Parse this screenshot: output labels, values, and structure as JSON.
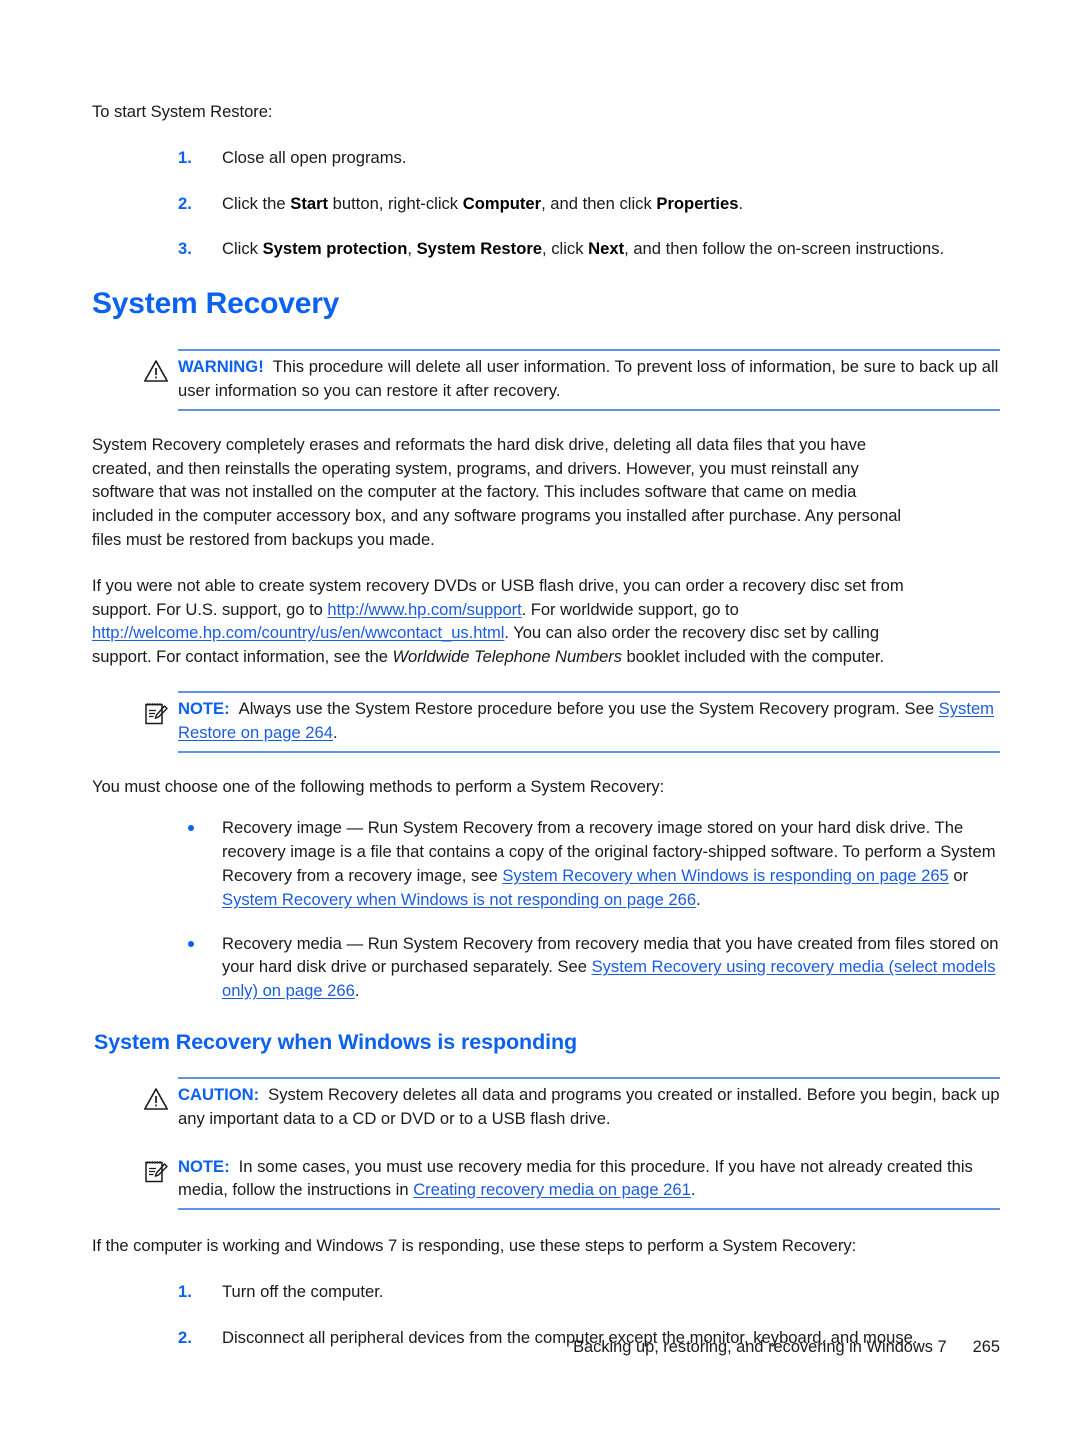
{
  "page": {
    "intro_line": "To start System Restore:",
    "steps_top": [
      {
        "num": "1.",
        "text": "Close all open programs."
      },
      {
        "num": "2.",
        "text": "Click the Start button, right-click Computer, and then click Properties."
      },
      {
        "num": "3.",
        "text": "Click System protection, System Restore, click Next, and then follow the on-screen instructions."
      }
    ],
    "heading_1": "System Recovery",
    "warning": {
      "icon": "warning-triangle-icon",
      "keyword": "WARNING!",
      "text": "This procedure will delete all user information. To prevent loss of information, be sure to back up all user information so you can restore it after recovery."
    },
    "para_1": "System Recovery completely erases and reformats the hard disk drive, deleting all data files that you have created, and then reinstalls the operating system, programs, and drivers. However, you must reinstall any software that was not installed on the computer at the factory. This includes software that came on media included in the computer accessory box, and any software programs you installed after purchase. Any personal files must be restored from backups you made.",
    "para_2": {
      "part_1": "If you were not able to create system recovery DVDs or USB flash drive, you can order a recovery disc set from support. For U.S. support, go to ",
      "url_1": "http://www.hp.com/support",
      "part_2": ". For worldwide support, go to ",
      "url_2": "http://welcome.hp.com/country/us/en/wwcontact_us.html",
      "part_3": ". You can also order the recovery disc set by calling support. For contact information, see the ",
      "italic_1": "Worldwide Telephone Numbers",
      "part_4": " booklet included with the computer."
    },
    "note_1": {
      "icon": "note-pad-pencil-icon",
      "keyword": "NOTE:",
      "text_1": "Always use the System Restore procedure before you use the System Recovery program. See ",
      "link_1": "System Restore on page 264",
      "text_2": "."
    },
    "para_3": "You must choose one of the following methods to perform a System Recovery:",
    "bullets": [
      {
        "text_1": "Recovery image — Run System Recovery from a recovery image stored on your hard disk drive. The recovery image is a file that contains a copy of the original factory-shipped software. To perform a System Recovery from a recovery image, see ",
        "link_1": "System Recovery when Windows is responding on page 265",
        "text_2": " or ",
        "link_2": "System Recovery when Windows is not responding on page 266",
        "text_3": "."
      },
      {
        "text_1": "Recovery media — Run System Recovery from recovery media that you have created from files stored on your hard disk drive or purchased separately. See ",
        "link_1": "System Recovery using recovery media (select models only) on page 266",
        "text_2": "."
      }
    ],
    "heading_2": "System Recovery when Windows is responding",
    "caution": {
      "icon": "warning-triangle-icon",
      "keyword": "CAUTION:",
      "text": "System Recovery deletes all data and programs you created or installed. Before you begin, back up any important data to a CD or DVD or to a USB flash drive."
    },
    "note_2": {
      "icon": "note-pad-pencil-icon",
      "keyword": "NOTE:",
      "text_1": "In some cases, you must use recovery media for this procedure. If you have not already created this media, follow the instructions in ",
      "link_1": "Creating recovery media on page 261",
      "text_2": "."
    },
    "para_4": "If the computer is working and Windows 7 is responding, use these steps to perform a System Recovery:",
    "steps_bottom": [
      {
        "num": "1.",
        "text": "Turn off the computer."
      },
      {
        "num": "2.",
        "text": "Disconnect all peripheral devices from the computer except the monitor, keyboard, and mouse."
      }
    ],
    "footer": {
      "text": "Backing up, restoring, and recovering in Windows 7",
      "page_number": "265"
    },
    "colors": {
      "heading_blue": "#0b61f0",
      "link_blue": "#1a5ce0",
      "rule_blue": "#5e93e6",
      "body_text": "#1a1a1a",
      "background": "#ffffff"
    }
  }
}
